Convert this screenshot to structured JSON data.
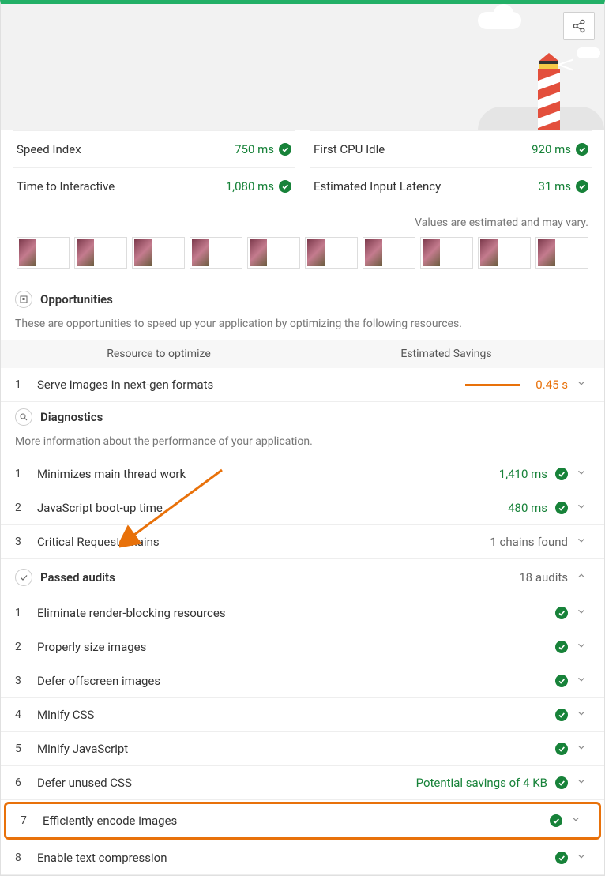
{
  "metrics": {
    "left": [
      {
        "label": "Speed Index",
        "value": "750 ms"
      },
      {
        "label": "Time to Interactive",
        "value": "1,080 ms"
      }
    ],
    "right": [
      {
        "label": "First CPU Idle",
        "value": "920 ms"
      },
      {
        "label": "Estimated Input Latency",
        "value": "31 ms"
      }
    ]
  },
  "estimate_note": "Values are estimated and may vary.",
  "opportunities": {
    "title": "Opportunities",
    "description": "These are opportunities to speed up your application by optimizing the following resources.",
    "col1": "Resource to optimize",
    "col2": "Estimated Savings",
    "items": [
      {
        "num": "1",
        "name": "Serve images in next-gen formats",
        "savings": "0.45 s"
      }
    ]
  },
  "diagnostics": {
    "title": "Diagnostics",
    "description": "More information about the performance of your application.",
    "items": [
      {
        "num": "1",
        "name": "Minimizes main thread work",
        "value": "1,410 ms",
        "pass": true
      },
      {
        "num": "2",
        "name": "JavaScript boot-up time",
        "value": "480 ms",
        "pass": true
      },
      {
        "num": "3",
        "name": "Critical Request Chains",
        "value": "1 chains found",
        "pass": false
      }
    ]
  },
  "passed": {
    "title": "Passed audits",
    "count": "18 audits",
    "items": [
      {
        "num": "1",
        "name": "Eliminate render-blocking resources"
      },
      {
        "num": "2",
        "name": "Properly size images"
      },
      {
        "num": "3",
        "name": "Defer offscreen images"
      },
      {
        "num": "4",
        "name": "Minify CSS"
      },
      {
        "num": "5",
        "name": "Minify JavaScript"
      },
      {
        "num": "6",
        "name": "Defer unused CSS",
        "extra": "Potential savings of 4 KB"
      },
      {
        "num": "7",
        "name": "Efficiently encode images",
        "highlight": true
      },
      {
        "num": "8",
        "name": "Enable text compression"
      }
    ]
  }
}
